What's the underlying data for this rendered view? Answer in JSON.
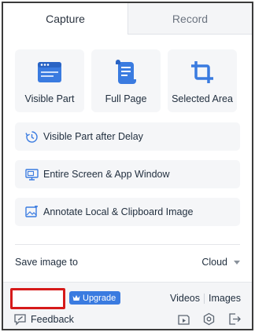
{
  "tabs": {
    "capture": "Capture",
    "record": "Record"
  },
  "cards": [
    {
      "label": "Visible Part",
      "icon": "browser-window-icon"
    },
    {
      "label": "Full Page",
      "icon": "scroll-page-icon"
    },
    {
      "label": "Selected Area",
      "icon": "crop-icon"
    }
  ],
  "rows": [
    {
      "label": "Visible Part after Delay",
      "icon": "timer-icon"
    },
    {
      "label": "Entire Screen & App Window",
      "icon": "monitor-icon"
    },
    {
      "label": "Annotate Local & Clipboard Image",
      "icon": "image-edit-icon"
    }
  ],
  "save": {
    "label": "Save image to",
    "value": "Cloud"
  },
  "footer": {
    "upgrade": "Upgrade",
    "videos": "Videos",
    "images": "Images",
    "feedback": "Feedback"
  },
  "colors": {
    "accent": "#3a7be0",
    "highlight_border": "#d61a1a"
  }
}
